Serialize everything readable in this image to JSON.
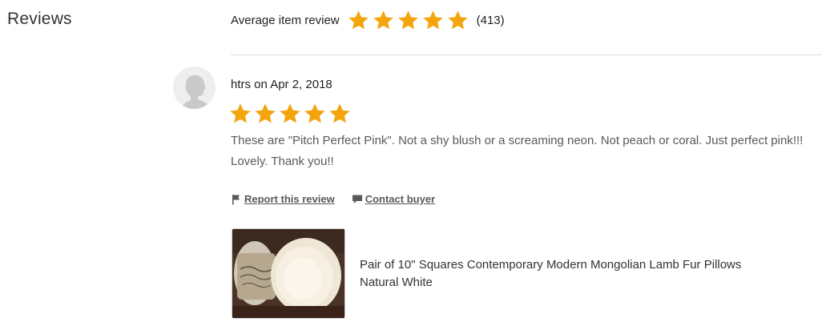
{
  "section": {
    "title": "Reviews"
  },
  "summary": {
    "label": "Average item review",
    "rating": 5,
    "count_text": "(413)",
    "star_icon": "star-icon",
    "star_color": "#F4A40C"
  },
  "review": {
    "reviewer_line": "htrs on Apr 2, 2018",
    "avatar_icon": "default-user-avatar-icon",
    "rating": 5,
    "text": "These are \"Pitch Perfect Pink\". Not a shy blush or a screaming neon. Not peach or coral. Just perfect pink!!! Lovely. Thank you!!",
    "actions": {
      "report_icon": "flag-icon",
      "report_label": "Report this review",
      "contact_icon": "message-icon",
      "contact_label": "Contact buyer"
    },
    "listing": {
      "title": "Pair of 10\" Squares Contemporary Modern Mongolian Lamb Fur Pillows Natural White"
    }
  },
  "colors": {
    "star": "#F4A40C",
    "divider": "#DDDDDD",
    "muted_text": "#595959"
  }
}
